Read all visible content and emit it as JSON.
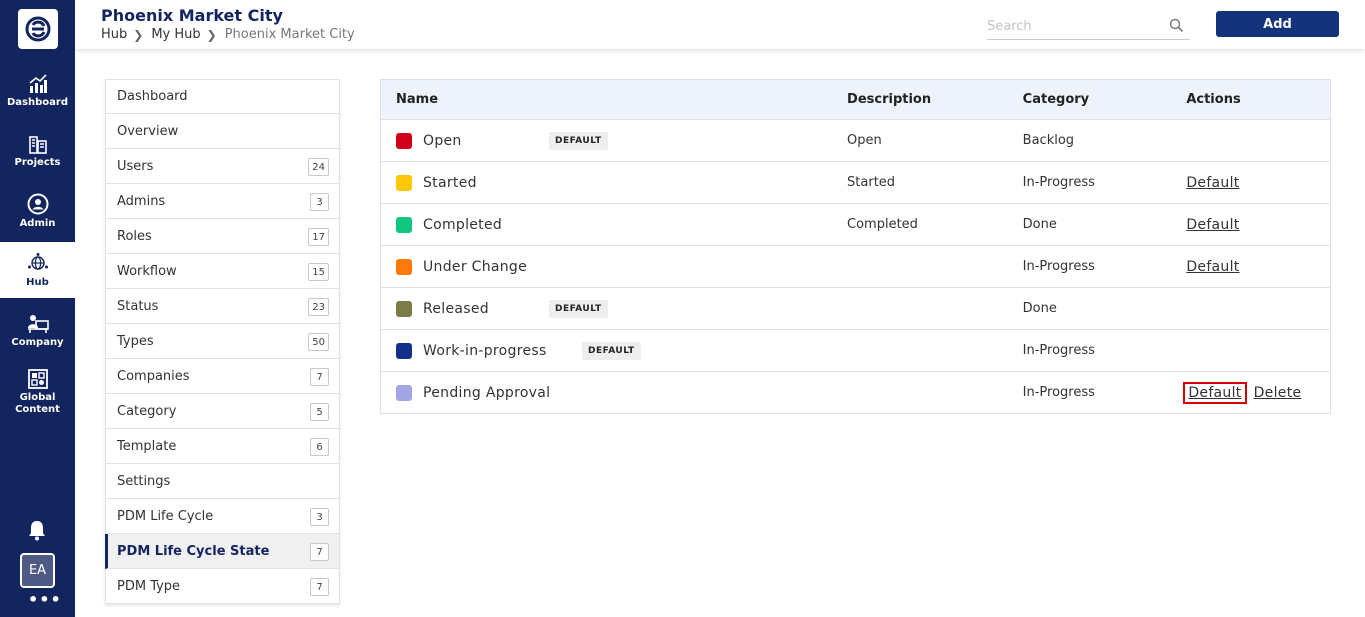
{
  "app": {
    "logo_icon": "e-logo-icon"
  },
  "rail": {
    "items": [
      {
        "label": "Dashboard",
        "icon": "chart-icon"
      },
      {
        "label": "Projects",
        "icon": "buildings-icon"
      },
      {
        "label": "Admin",
        "icon": "admin-user-icon"
      },
      {
        "label": "Hub",
        "icon": "hub-globe-icon",
        "active": true
      },
      {
        "label": "Company",
        "icon": "company-icon"
      },
      {
        "label": "Global\nContent",
        "icon": "global-content-icon"
      }
    ],
    "bell_icon": "bell-icon",
    "avatar": "EA",
    "more": "•••"
  },
  "header": {
    "title": "Phoenix Market City",
    "breadcrumb": [
      "Hub",
      "My Hub",
      "Phoenix Market City"
    ],
    "search_placeholder": "Search",
    "add_label": "Add"
  },
  "menu": {
    "items": [
      {
        "label": "Dashboard",
        "count": ""
      },
      {
        "label": "Overview",
        "count": ""
      },
      {
        "label": "Users",
        "count": "24"
      },
      {
        "label": "Admins",
        "count": "3"
      },
      {
        "label": "Roles",
        "count": "17"
      },
      {
        "label": "Workflow",
        "count": "15"
      },
      {
        "label": "Status",
        "count": "23"
      },
      {
        "label": "Types",
        "count": "50"
      },
      {
        "label": "Companies",
        "count": "7"
      },
      {
        "label": "Category",
        "count": "5"
      },
      {
        "label": "Template",
        "count": "6"
      },
      {
        "label": "Settings",
        "count": ""
      },
      {
        "label": "PDM Life Cycle",
        "count": "3"
      },
      {
        "label": "PDM Life Cycle State",
        "count": "7",
        "active": true
      },
      {
        "label": "PDM Type",
        "count": "7"
      }
    ]
  },
  "table": {
    "headers": {
      "name": "Name",
      "description": "Description",
      "category": "Category",
      "actions": "Actions"
    },
    "rows": [
      {
        "name": "Open",
        "color": "#d0021b",
        "badge": "DEFAULT",
        "description": "Open",
        "category": "Backlog",
        "default_link": "",
        "delete_link": ""
      },
      {
        "name": "Started",
        "color": "#ffc709",
        "badge": "",
        "description": "Started",
        "category": "In-Progress",
        "default_link": "Default",
        "delete_link": ""
      },
      {
        "name": "Completed",
        "color": "#11c47f",
        "badge": "",
        "description": "Completed",
        "category": "Done",
        "default_link": "Default",
        "delete_link": ""
      },
      {
        "name": "Under Change",
        "color": "#ff7a0d",
        "badge": "",
        "description": "",
        "category": "In-Progress",
        "default_link": "Default",
        "delete_link": ""
      },
      {
        "name": "Released",
        "color": "#7c7c48",
        "badge": "DEFAULT",
        "description": "",
        "category": "Done",
        "default_link": "",
        "delete_link": ""
      },
      {
        "name": "Work-in-progress",
        "color": "#12308a",
        "badge": "DEFAULT",
        "description": "",
        "category": "In-Progress",
        "default_link": "",
        "delete_link": ""
      },
      {
        "name": "Pending Approval",
        "color": "#a3a6e4",
        "badge": "",
        "description": "",
        "category": "In-Progress",
        "default_link": "Default",
        "delete_link": "Delete",
        "highlight": true
      }
    ]
  },
  "colors": {
    "rail_bg": "#13255e",
    "accent": "#13337a",
    "highlight_outline": "#d60000"
  }
}
